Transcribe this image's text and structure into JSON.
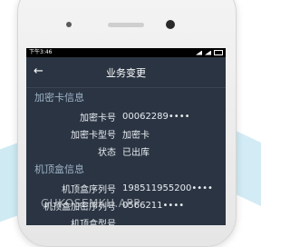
{
  "statusbar": {
    "time": "下午3:46",
    "battery_label": ""
  },
  "header": {
    "title": "业务变更"
  },
  "sections": [
    {
      "title": "加密卡信息",
      "rows": [
        {
          "label": "加密卡号",
          "value": "00062289••••"
        },
        {
          "label": "加密卡型号",
          "value": "加密卡"
        },
        {
          "label": "状态",
          "value": "已出库"
        }
      ]
    },
    {
      "title": "机顶盒信息",
      "rows": [
        {
          "label": "机顶盒序列号",
          "value": "198511955200••••"
        },
        {
          "label": "机顶盒加密序列号",
          "value": "0566211••••"
        },
        {
          "label": "机顶盒型号",
          "value": ""
        }
      ]
    }
  ],
  "watermark": "GUKOSEMKH.APP"
}
